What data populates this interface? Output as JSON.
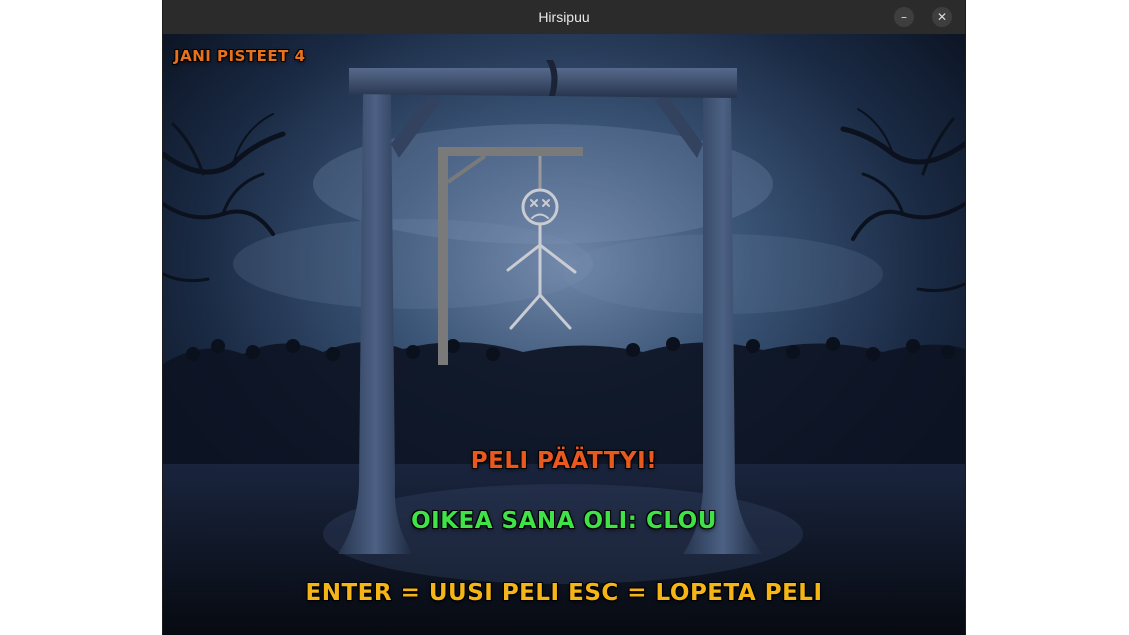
{
  "window": {
    "title": "Hirsipuu"
  },
  "controls": {
    "minimize_glyph": "–",
    "close_glyph": "✕"
  },
  "game": {
    "score_text": "JANI PISTEET 4",
    "game_over_text": "PELI PÄÄTTYI!",
    "correct_word_text": "OIKEA SANA OLI: CLOU",
    "instructions_text": "ENTER = UUSI PELI ESC = LOPETA PELI"
  },
  "colors": {
    "score": "#e8711d",
    "game_over": "#e9581f",
    "correct_word": "#3fe348",
    "instructions": "#f5b517",
    "gallows_drawing": "#7a7a7a",
    "stick_figure": "#c9ccd3"
  },
  "hangman_state": {
    "parts_drawn": [
      "head",
      "body",
      "left-arm",
      "right-arm",
      "left-leg",
      "right-leg"
    ],
    "face": "dead"
  }
}
